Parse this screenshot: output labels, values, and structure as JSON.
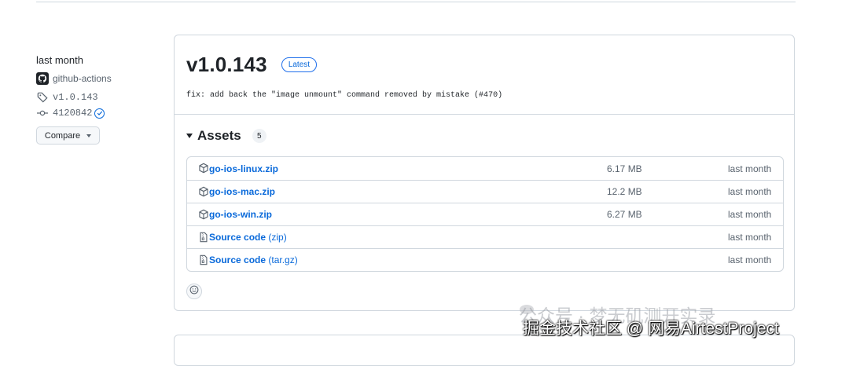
{
  "sidebar": {
    "time": "last month",
    "author": "github-actions",
    "tag": "v1.0.143",
    "commit": "4120842",
    "compare_label": "Compare"
  },
  "release": {
    "version": "v1.0.143",
    "badge": "Latest",
    "description": "fix: add back the \"image unmount\" command removed by mistake (#470)"
  },
  "assets": {
    "title": "Assets",
    "count": "5",
    "items": [
      {
        "name": "go-ios-linux.zip",
        "ext": "",
        "size": "6.17 MB",
        "when": "last month",
        "icon": "package-icon"
      },
      {
        "name": "go-ios-mac.zip",
        "ext": "",
        "size": "12.2 MB",
        "when": "last month",
        "icon": "package-icon"
      },
      {
        "name": "go-ios-win.zip",
        "ext": "",
        "size": "6.27 MB",
        "when": "last month",
        "icon": "package-icon"
      },
      {
        "name": "Source code",
        "ext": "(zip)",
        "size": "",
        "when": "last month",
        "icon": "file-zip-icon"
      },
      {
        "name": "Source code",
        "ext": "(tar.gz)",
        "size": "",
        "when": "last month",
        "icon": "file-zip-icon"
      }
    ]
  },
  "watermark": {
    "line1": "公众号 · 梦无矶测开实录",
    "line2": "掘金技术社区 @ 网易AirtestProject"
  },
  "colors": {
    "link": "#0969da",
    "border": "#d0d7de",
    "muted": "#59636e"
  }
}
